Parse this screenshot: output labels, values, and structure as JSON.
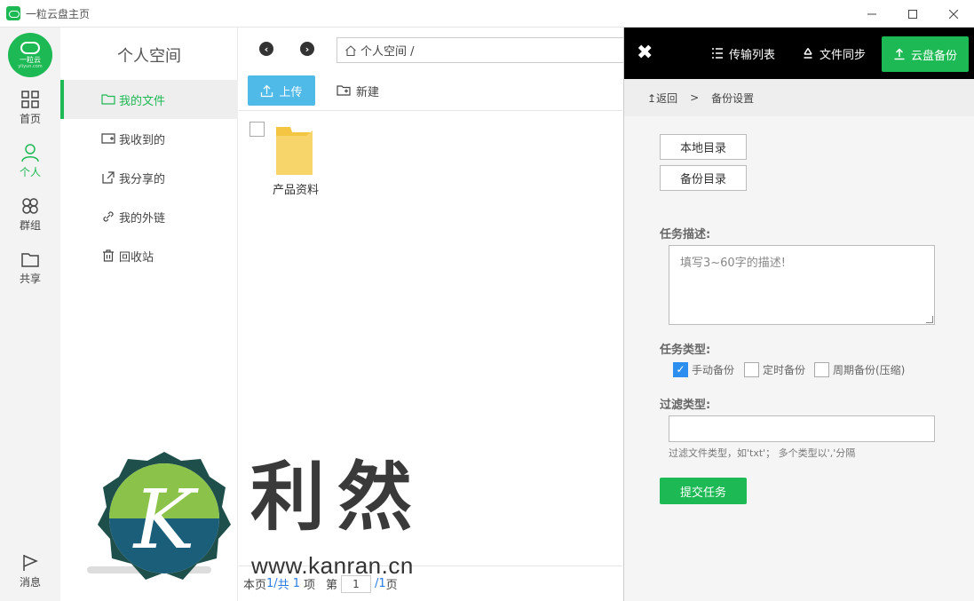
{
  "window": {
    "title": "一粒云盘主页",
    "controls": [
      "minimize-icon",
      "maximize-icon",
      "close-icon"
    ]
  },
  "logo": {
    "name": "一粒云",
    "sub": "yliyun.com"
  },
  "iconbar": {
    "items": [
      {
        "label": "首页",
        "icon": "grid-icon"
      },
      {
        "label": "个人",
        "icon": "person-icon"
      },
      {
        "label": "群组",
        "icon": "group-icon"
      },
      {
        "label": "共享",
        "icon": "folder-icon"
      }
    ],
    "message": {
      "label": "消息",
      "icon": "flag-icon"
    }
  },
  "sidebar": {
    "title": "个人空间",
    "items": [
      {
        "label": "我的文件",
        "icon": "folder-icon"
      },
      {
        "label": "我收到的",
        "icon": "inbox-icon"
      },
      {
        "label": "我分享的",
        "icon": "share-icon"
      },
      {
        "label": "我的外链",
        "icon": "link-icon"
      },
      {
        "label": "回收站",
        "icon": "trash-icon"
      }
    ]
  },
  "main": {
    "path": "个人空间 /",
    "upload_label": "上传",
    "new_label": "新建",
    "files": [
      {
        "name": "产品资料",
        "type": "folder"
      }
    ],
    "footer": {
      "page_prefix": "本页",
      "page_count": "1/",
      "total_prefix": "共",
      "total": "1",
      "item_unit": "项",
      "page_label": "第",
      "page_value": "1",
      "page_total": "/1",
      "page_unit": "页"
    }
  },
  "panel": {
    "header": {
      "transfer_label": "传输列表",
      "sync_label": "文件同步",
      "backup_label": "云盘备份"
    },
    "breadcrumb": {
      "back_label": "返回",
      "separator": ">",
      "current": "备份设置"
    },
    "local_dir_label": "本地目录",
    "backup_dir_label": "备份目录",
    "desc_label": "任务描述:",
    "desc_placeholder": "填写3~60字的描述!",
    "type_label": "任务类型:",
    "types": [
      {
        "label": "手动备份",
        "checked": true
      },
      {
        "label": "定时备份",
        "checked": false
      },
      {
        "label": "周期备份(压缩)",
        "checked": false
      }
    ],
    "filter_label": "过滤类型:",
    "filter_hint": "过滤文件类型，如'txt'； 多个类型以','分隔",
    "submit_label": "提交任务"
  },
  "watermark": {
    "text": "利然",
    "url": "www.kanran.cn"
  },
  "colors": {
    "accent": "#1db954",
    "upload": "#4fb9e8",
    "checkbox": "#2c8ef0",
    "header": "#000000"
  }
}
